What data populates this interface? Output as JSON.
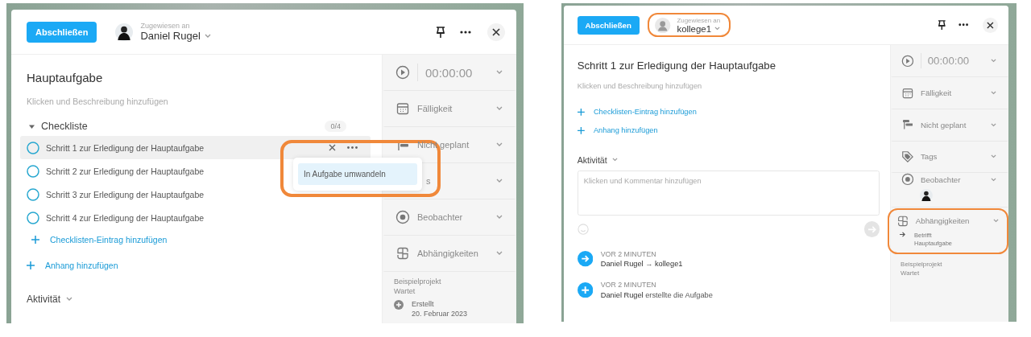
{
  "screenshots": [
    {
      "header": {
        "complete_button": "Abschließen",
        "assignee_label": "Zugewiesen an",
        "assignee": "Daniel Rugel",
        "avatar": {
          "kind": "photo"
        },
        "highlighted": false
      },
      "title": "Hauptaufgabe",
      "description_placeholder": "Klicken und Beschreibung hinzufügen",
      "checklist": {
        "title": "Checkliste",
        "count": "0/4",
        "expanded": true,
        "items": [
          {
            "label": "Schritt 1 zur Erledigung der Hauptaufgabe",
            "checked": false,
            "hovered": true
          },
          {
            "label": "Schritt 2 zur Erledigung der Hauptaufgabe",
            "checked": false,
            "hovered": false
          },
          {
            "label": "Schritt 3 zur Erledigung der Hauptaufgabe",
            "checked": false,
            "hovered": false
          },
          {
            "label": "Schritt 4 zur Erledigung der Hauptaufgabe",
            "checked": false,
            "hovered": false
          }
        ],
        "add_link": "Checklisten-Eintrag hinzufügen"
      },
      "links": [
        "Anhang hinzufügen"
      ],
      "activity": {
        "heading": "Aktivität"
      },
      "menu": {
        "highlighted": true,
        "items": [
          {
            "label": "In Aufgabe umwandeln",
            "selected": true
          }
        ]
      },
      "sidebar": [
        {
          "kind": "timer",
          "label": "00:00:00"
        },
        {
          "kind": "due",
          "label": "Fälligkeit"
        },
        {
          "kind": "schedule",
          "label": "Nicht geplant"
        },
        {
          "kind": "partial",
          "label": "s"
        },
        {
          "kind": "watchers",
          "label": "Beobachter"
        },
        {
          "kind": "dependencies",
          "label": "Abhängigkeiten",
          "highlighted": false
        }
      ],
      "project": {
        "name": "Beispielprojekt",
        "status": "Wartet",
        "created_label": "Erstellt",
        "created_date": "20. Februar 2023"
      }
    },
    {
      "header": {
        "complete_button": "Abschließen",
        "assignee_label": "Zugewiesen an",
        "assignee": "kollege1",
        "avatar": {
          "kind": "placeholder"
        },
        "highlighted": true
      },
      "title": "Schritt 1 zur Erledigung der Hauptaufgabe",
      "description_placeholder": "Klicken und Beschreibung hinzufügen",
      "links": [
        "Checklisten-Eintrag hinzufügen",
        "Anhang hinzufügen"
      ],
      "activity": {
        "heading": "Aktivität",
        "comment_placeholder": "Klicken und Kommentar hinzufügen",
        "entries": [
          {
            "kind": "reassign",
            "time": "VOR 2 MINUTEN",
            "text": "**Daniel Rugel** → **kollege1**"
          },
          {
            "kind": "created",
            "time": "VOR 2 MINUTEN",
            "text": "**Daniel Rugel** erstellte die Aufgabe"
          }
        ]
      },
      "sidebar": [
        {
          "kind": "timer",
          "label": "00:00:00"
        },
        {
          "kind": "due",
          "label": "Fälligkeit"
        },
        {
          "kind": "schedule",
          "label": "Nicht geplant"
        },
        {
          "kind": "tags",
          "label": "Tags"
        },
        {
          "kind": "watchers",
          "label": "Beobachter",
          "avatar": {
            "kind": "photo"
          }
        },
        {
          "kind": "dependencies",
          "label": "Abhängigkeiten",
          "highlighted": true,
          "relation": "Betrifft",
          "target": "Hauptaufgabe"
        }
      ],
      "project": {
        "name": "Beispielprojekt",
        "status": "Wartet"
      }
    }
  ]
}
